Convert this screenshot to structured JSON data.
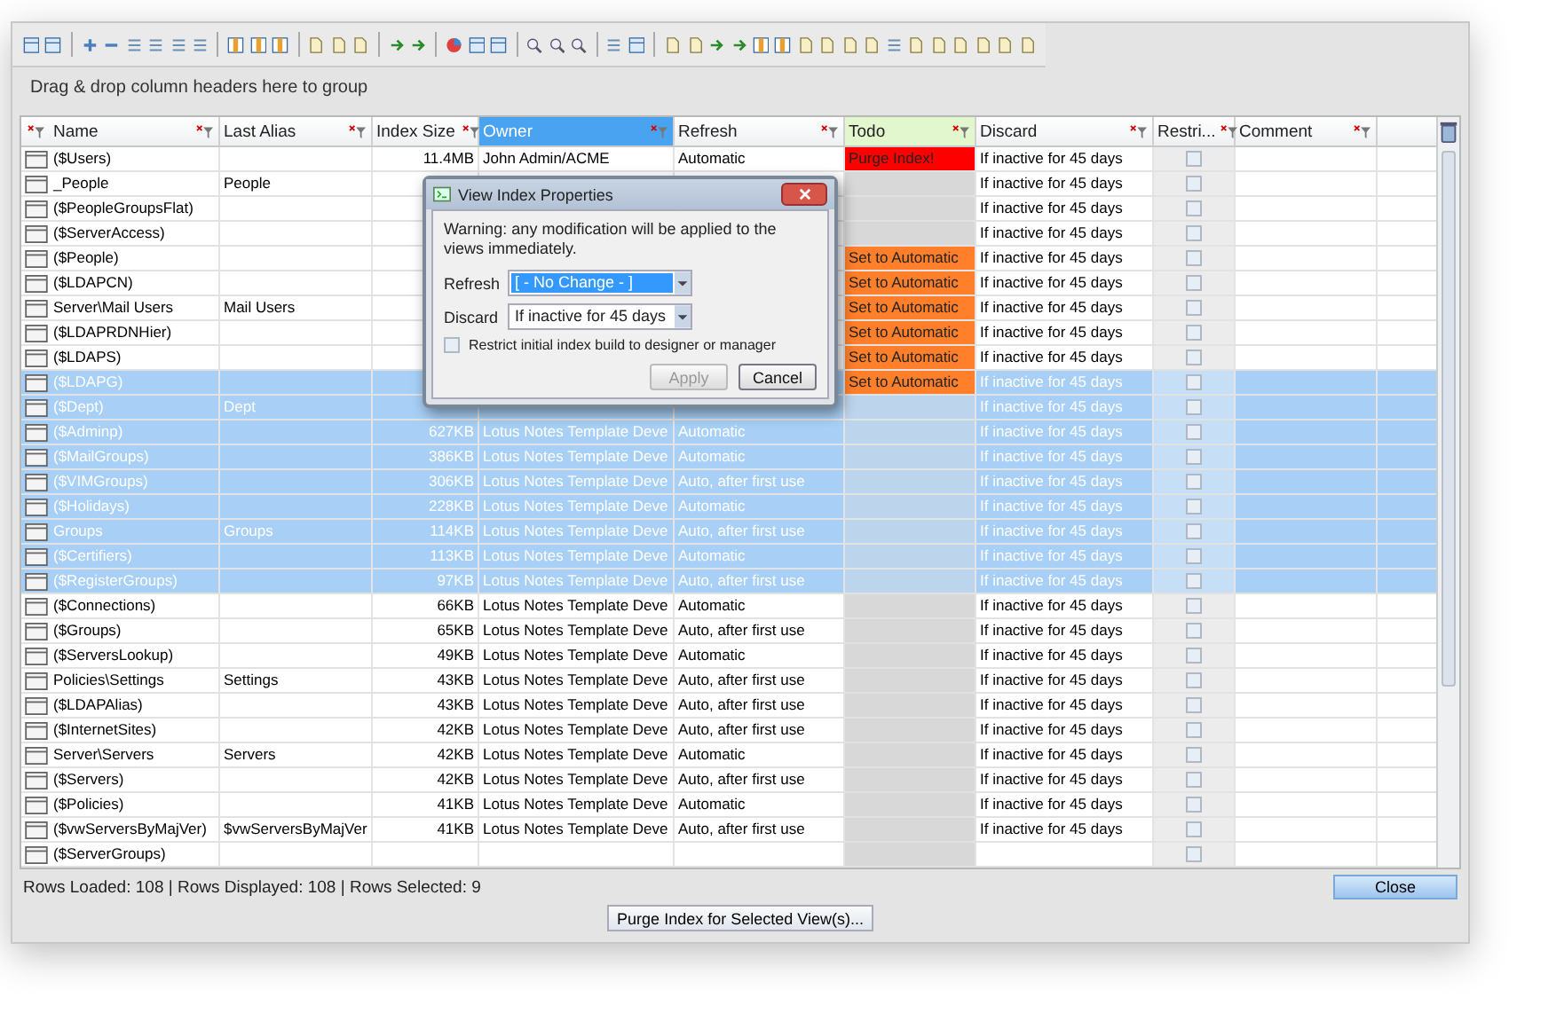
{
  "group_hint": "Drag & drop column headers here to group",
  "columns": [
    {
      "label": "Name",
      "selected": false
    },
    {
      "label": "Last Alias",
      "selected": false
    },
    {
      "label": "Index Size",
      "selected": false
    },
    {
      "label": "Owner",
      "selected": true
    },
    {
      "label": "Refresh",
      "selected": false
    },
    {
      "label": "Todo",
      "selected": false,
      "color": "#e3f7cf"
    },
    {
      "label": "Discard",
      "selected": false
    },
    {
      "label": "Restri...",
      "selected": false
    },
    {
      "label": "Comment",
      "selected": false
    }
  ],
  "rows": [
    {
      "name": "($Users)",
      "size": "11.4MB",
      "owner": "John Admin/ACME",
      "refresh": "Automatic",
      "todo": {
        "text": "Purge Index!",
        "color": "#ff0000"
      },
      "discard": "If inactive for 45 days",
      "restricted": false,
      "selected": false
    },
    {
      "name": "_People",
      "alias": "People",
      "discard": "If inactive for 45 days",
      "restricted": false,
      "selected": false
    },
    {
      "name": "($PeopleGroupsFlat)",
      "discard": "If inactive for 45 days",
      "restricted": false,
      "selected": false
    },
    {
      "name": "($ServerAccess)",
      "discard": "If inactive for 45 days",
      "restricted": false,
      "selected": false
    },
    {
      "name": "($People)",
      "todo": {
        "text": "Set to Automatic",
        "color": "#ff7f2a"
      },
      "discard": "If inactive for 45 days",
      "restricted": false,
      "selected": false
    },
    {
      "name": "($LDAPCN)",
      "todo": {
        "text": "Set to Automatic",
        "color": "#ff7f2a"
      },
      "discard": "If inactive for 45 days",
      "restricted": false,
      "selected": false
    },
    {
      "name": "Server\\Mail Users",
      "alias": "Mail Users",
      "todo": {
        "text": "Set to Automatic",
        "color": "#ff7f2a"
      },
      "discard": "If inactive for 45 days",
      "restricted": false,
      "selected": false
    },
    {
      "name": "($LDAPRDNHier)",
      "todo": {
        "text": "Set to Automatic",
        "color": "#ff7f2a"
      },
      "discard": "If inactive for 45 days",
      "restricted": false,
      "selected": false
    },
    {
      "name": "($LDAPS)",
      "todo": {
        "text": "Set to Automatic",
        "color": "#ff7f2a"
      },
      "discard": "If inactive for 45 days",
      "restricted": false,
      "selected": false
    },
    {
      "name": "($LDAPG)",
      "todo": {
        "text": "Set to Automatic",
        "color": "#ff7f2a"
      },
      "discard": "If inactive for 45 days",
      "restricted": false,
      "selected": true
    },
    {
      "name": "($Dept)",
      "alias": "Dept",
      "discard": "If inactive for 45 days",
      "restricted": false,
      "selected": true
    },
    {
      "name": "($Adminp)",
      "size": "627KB",
      "owner": "Lotus Notes Template Deve",
      "refresh": "Automatic",
      "discard": "If inactive for 45 days",
      "restricted": false,
      "selected": true
    },
    {
      "name": "($MailGroups)",
      "size": "386KB",
      "owner": "Lotus Notes Template Deve",
      "refresh": "Automatic",
      "discard": "If inactive for 45 days",
      "restricted": false,
      "selected": true
    },
    {
      "name": "($VIMGroups)",
      "size": "306KB",
      "owner": "Lotus Notes Template Deve",
      "refresh": "Auto, after first use",
      "discard": "If inactive for 45 days",
      "restricted": false,
      "selected": true
    },
    {
      "name": "($Holidays)",
      "size": "228KB",
      "owner": "Lotus Notes Template Deve",
      "refresh": "Automatic",
      "discard": "If inactive for 45 days",
      "restricted": false,
      "selected": true
    },
    {
      "name": "Groups",
      "alias": "Groups",
      "size": "114KB",
      "owner": "Lotus Notes Template Deve",
      "refresh": "Auto, after first use",
      "discard": "If inactive for 45 days",
      "restricted": false,
      "selected": true
    },
    {
      "name": "($Certifiers)",
      "size": "113KB",
      "owner": "Lotus Notes Template Deve",
      "refresh": "Automatic",
      "discard": "If inactive for 45 days",
      "restricted": false,
      "selected": true
    },
    {
      "name": "($RegisterGroups)",
      "size": "97KB",
      "owner": "Lotus Notes Template Deve",
      "refresh": "Auto, after first use",
      "discard": "If inactive for 45 days",
      "restricted": false,
      "selected": true
    },
    {
      "name": "($Connections)",
      "size": "66KB",
      "owner": "Lotus Notes Template Deve",
      "refresh": "Automatic",
      "discard": "If inactive for 45 days",
      "restricted": false,
      "selected": false
    },
    {
      "name": "($Groups)",
      "size": "65KB",
      "owner": "Lotus Notes Template Deve",
      "refresh": "Auto, after first use",
      "discard": "If inactive for 45 days",
      "restricted": false,
      "selected": false
    },
    {
      "name": "($ServersLookup)",
      "size": "49KB",
      "owner": "Lotus Notes Template Deve",
      "refresh": "Automatic",
      "discard": "If inactive for 45 days",
      "restricted": false,
      "selected": false
    },
    {
      "name": "Policies\\Settings",
      "alias": "Settings",
      "size": "43KB",
      "owner": "Lotus Notes Template Deve",
      "refresh": "Auto, after first use",
      "discard": "If inactive for 45 days",
      "restricted": false,
      "selected": false
    },
    {
      "name": "($LDAPAlias)",
      "size": "43KB",
      "owner": "Lotus Notes Template Deve",
      "refresh": "Auto, after first use",
      "discard": "If inactive for 45 days",
      "restricted": false,
      "selected": false
    },
    {
      "name": "($InternetSites)",
      "size": "42KB",
      "owner": "Lotus Notes Template Deve",
      "refresh": "Auto, after first use",
      "discard": "If inactive for 45 days",
      "restricted": false,
      "selected": false
    },
    {
      "name": "Server\\Servers",
      "alias": "Servers",
      "size": "42KB",
      "owner": "Lotus Notes Template Deve",
      "refresh": "Automatic",
      "discard": "If inactive for 45 days",
      "restricted": false,
      "selected": false
    },
    {
      "name": "($Servers)",
      "size": "42KB",
      "owner": "Lotus Notes Template Deve",
      "refresh": "Auto, after first use",
      "discard": "If inactive for 45 days",
      "restricted": false,
      "selected": false
    },
    {
      "name": "($Policies)",
      "size": "41KB",
      "owner": "Lotus Notes Template Deve",
      "refresh": "Automatic",
      "discard": "If inactive for 45 days",
      "restricted": false,
      "selected": false
    },
    {
      "name": "($vwServersByMajVer)",
      "alias": "$vwServersByMajVer",
      "size": "41KB",
      "owner": "Lotus Notes Template Deve",
      "refresh": "Auto, after first use",
      "discard": "If inactive for 45 days",
      "restricted": false,
      "selected": false
    },
    {
      "name": "($ServerGroups)",
      "restricted": false,
      "selected": false
    }
  ],
  "dialog": {
    "title": "View Index Properties",
    "warning": "Warning: any modification will be applied to the views immediately.",
    "fields": [
      {
        "label": "Refresh",
        "value": "[ - No Change - ]",
        "selected": true
      },
      {
        "label": "Discard",
        "value": "If inactive for 45 days",
        "selected": false
      }
    ],
    "checkbox": {
      "label": "Restrict initial index build to designer or manager",
      "checked": false
    },
    "buttons": [
      {
        "label": "Apply",
        "disabled": true
      },
      {
        "label": "Cancel",
        "disabled": false
      }
    ]
  },
  "status_bar": "Rows Loaded: 108  |  Rows Displayed: 108  |  Rows Selected: 9",
  "purge_button": "Purge Index for Selected View(s)...",
  "close_button": "Close"
}
